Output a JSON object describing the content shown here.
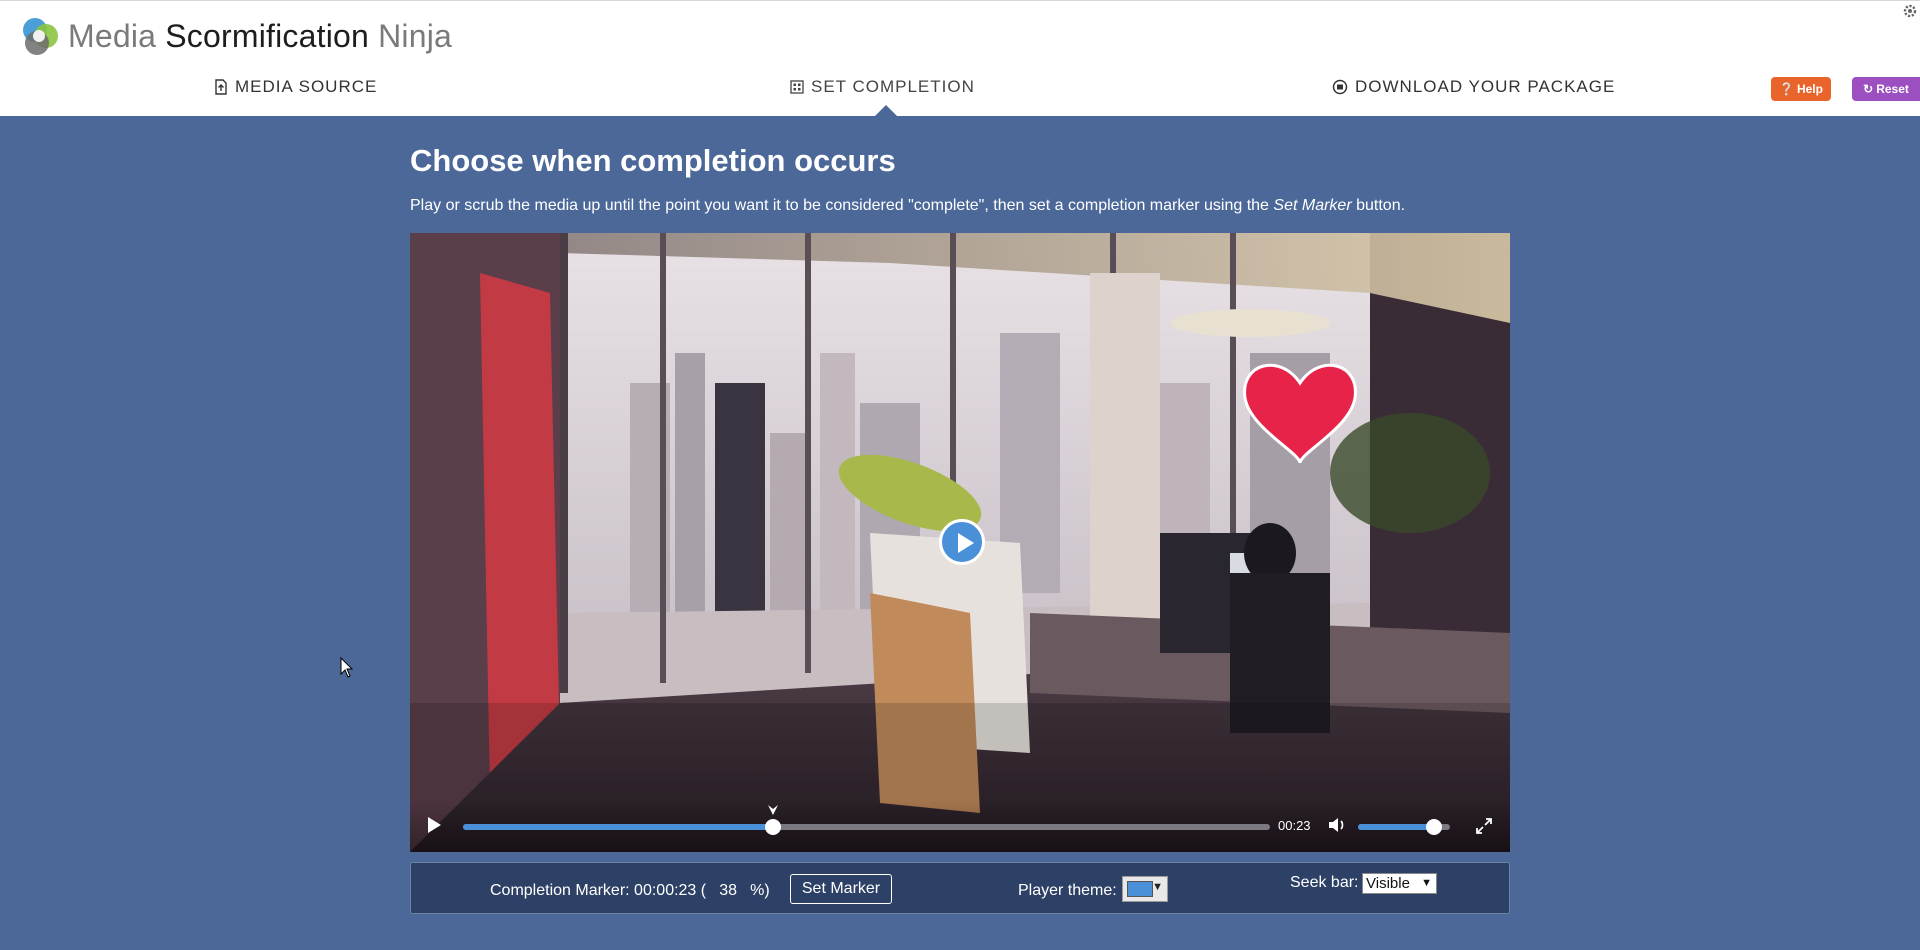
{
  "app": {
    "logo_word1": "Media",
    "logo_word2": "Scormification",
    "logo_word3": "Ninja"
  },
  "nav": {
    "tabs": [
      {
        "label": "MEDIA SOURCE",
        "icon": "upload-file-icon"
      },
      {
        "label": "SET COMPLETION",
        "icon": "grid-icon",
        "active": true
      },
      {
        "label": "DOWNLOAD YOUR PACKAGE",
        "icon": "download-circle-icon"
      }
    ],
    "help_label": "Help",
    "reset_label": "Reset"
  },
  "colors": {
    "background": "#4b6899",
    "help": "#e9642b",
    "reset": "#9b4fc0",
    "player_accent": "#4a90d9"
  },
  "main": {
    "title": "Choose when completion occurs",
    "instructions_pre": "Play or scrub the media up until the point you want it to be considered \"complete\", then set a completion marker using the",
    "instructions_em": "Set Marker",
    "instructions_post": "button."
  },
  "player": {
    "current_time": "00:23",
    "progress": 0.384,
    "marker_position": 0.384,
    "volume": 0.83
  },
  "completion": {
    "marker_prefix": "Completion Marker: 00:00:23 (",
    "percent": "38",
    "marker_suffix": "%)",
    "set_marker_label": "Set Marker",
    "theme_label": "Player theme:",
    "theme_color": "#4a90d9",
    "seek_label": "Seek bar:",
    "seek_value": "Visible"
  }
}
